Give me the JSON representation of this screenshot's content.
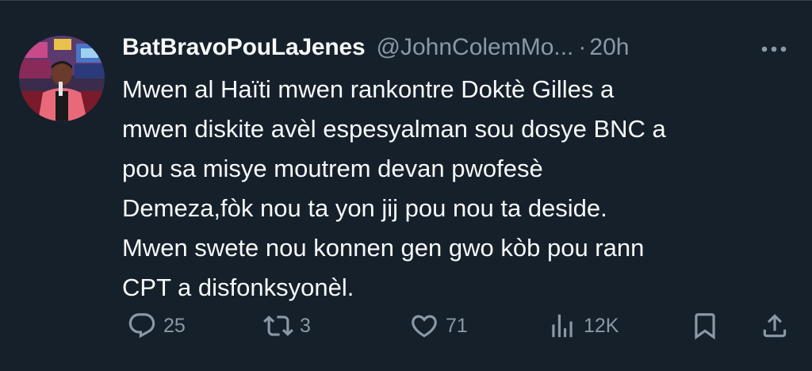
{
  "tweet": {
    "display_name": "BatBravoPouLaJenes",
    "handle": "@JohnColemMo...",
    "separator": "·",
    "time": "20h",
    "text_lines": [
      "Mwen al Haïti mwen rankontre Doktè Gilles a",
      "mwen diskite avèl espesyalman sou dosye BNC a",
      "pou sa misye moutrem devan pwofesè",
      "Demeza,fòk nou ta yon jij pou nou ta deside.",
      "Mwen swete nou konnen gen gwo kòb pou rann",
      "CPT a disfonksyonèl."
    ]
  },
  "actions": {
    "reply_count": "25",
    "retweet_count": "3",
    "like_count": "71",
    "views_count": "12K"
  },
  "icons": {
    "more": "more-horizontal-icon",
    "reply": "reply-icon",
    "retweet": "retweet-icon",
    "like": "heart-icon",
    "views": "views-icon",
    "bookmark": "bookmark-icon",
    "share": "share-icon"
  },
  "colors": {
    "background": "#15202b",
    "text": "#f7f9f9",
    "secondary": "#8b98a5",
    "border": "#38444d"
  }
}
